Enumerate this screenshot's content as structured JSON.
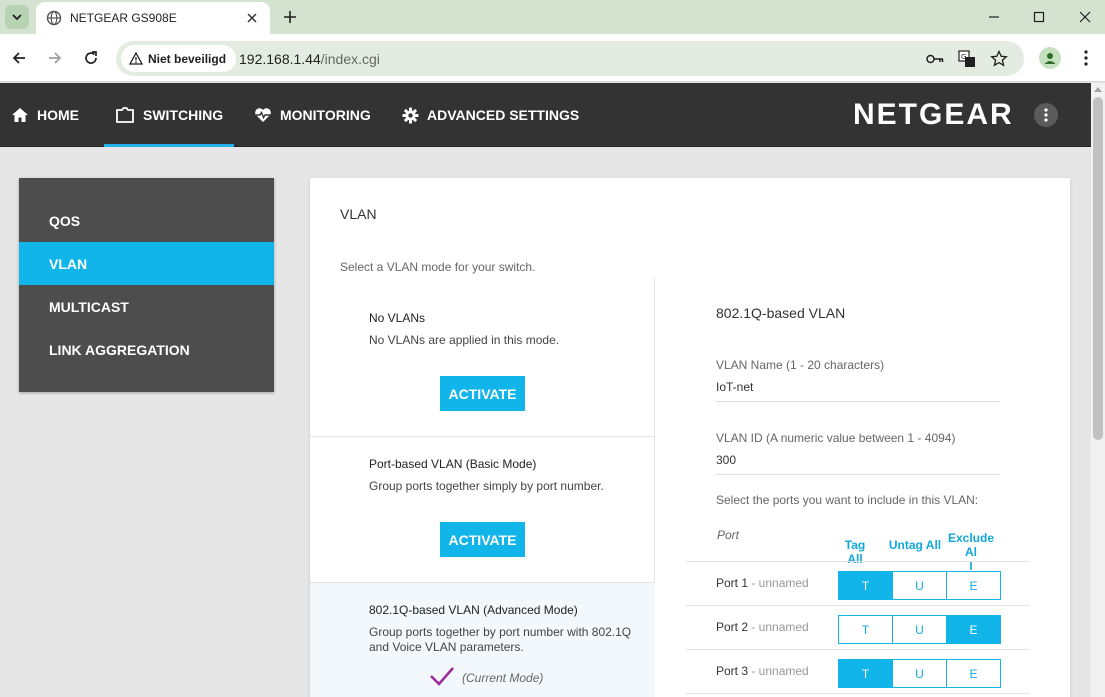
{
  "browser": {
    "tab_title": "NETGEAR GS908E",
    "security_label": "Niet beveiligd",
    "url_host": "192.168.1.44",
    "url_path": "/index.cgi"
  },
  "topnav": {
    "items": [
      {
        "label": "HOME",
        "icon": "home-icon"
      },
      {
        "label": "SWITCHING",
        "icon": "switching-icon"
      },
      {
        "label": "MONITORING",
        "icon": "heart-pulse-icon"
      },
      {
        "label": "ADVANCED SETTINGS",
        "icon": "gear-icon"
      }
    ],
    "active": "SWITCHING",
    "logo": "NETGEAR"
  },
  "sidebar": {
    "items": [
      {
        "label": "QOS"
      },
      {
        "label": "VLAN"
      },
      {
        "label": "MULTICAST"
      },
      {
        "label": "LINK AGGREGATION"
      }
    ],
    "active": "VLAN"
  },
  "panel": {
    "title": "VLAN",
    "subtitle": "Select a VLAN mode for your switch.",
    "modes": [
      {
        "title": "No VLANs",
        "description": "No VLANs are applied in this mode.",
        "button": "ACTIVATE"
      },
      {
        "title": "Port-based VLAN (Basic Mode)",
        "description": "Group ports together simply by port number.",
        "button": "ACTIVATE"
      },
      {
        "title": "802.1Q-based VLAN (Advanced Mode)",
        "description": "Group ports together by port number with 802.1Q and Voice VLAN parameters.",
        "current_label": "(Current Mode)"
      }
    ],
    "config": {
      "title": "802.1Q-based VLAN",
      "name_label": "VLAN Name (1 - 20 characters)",
      "name_value": "IoT-net",
      "id_label": "VLAN ID (A numeric value between 1 - 4094)",
      "id_value": "300",
      "ports_hint": "Select the ports you want to include in this VLAN:",
      "port_header": "Port",
      "tag_all": "Tag All",
      "untag_all": "Untag All",
      "exclude_all_1": "Exclude Al",
      "exclude_all_2": "l",
      "ports": [
        {
          "name": "Port 1",
          "suffix": " - unnamed",
          "selected": "T"
        },
        {
          "name": "Port 2",
          "suffix": " - unnamed",
          "selected": "E"
        },
        {
          "name": "Port 3",
          "suffix": " - unnamed",
          "selected": "T"
        }
      ],
      "options": [
        "T",
        "U",
        "E"
      ]
    }
  },
  "colors": {
    "accent": "#12b5ea",
    "nav_bg": "#333333",
    "sidebar_bg": "#4d4d4d"
  }
}
